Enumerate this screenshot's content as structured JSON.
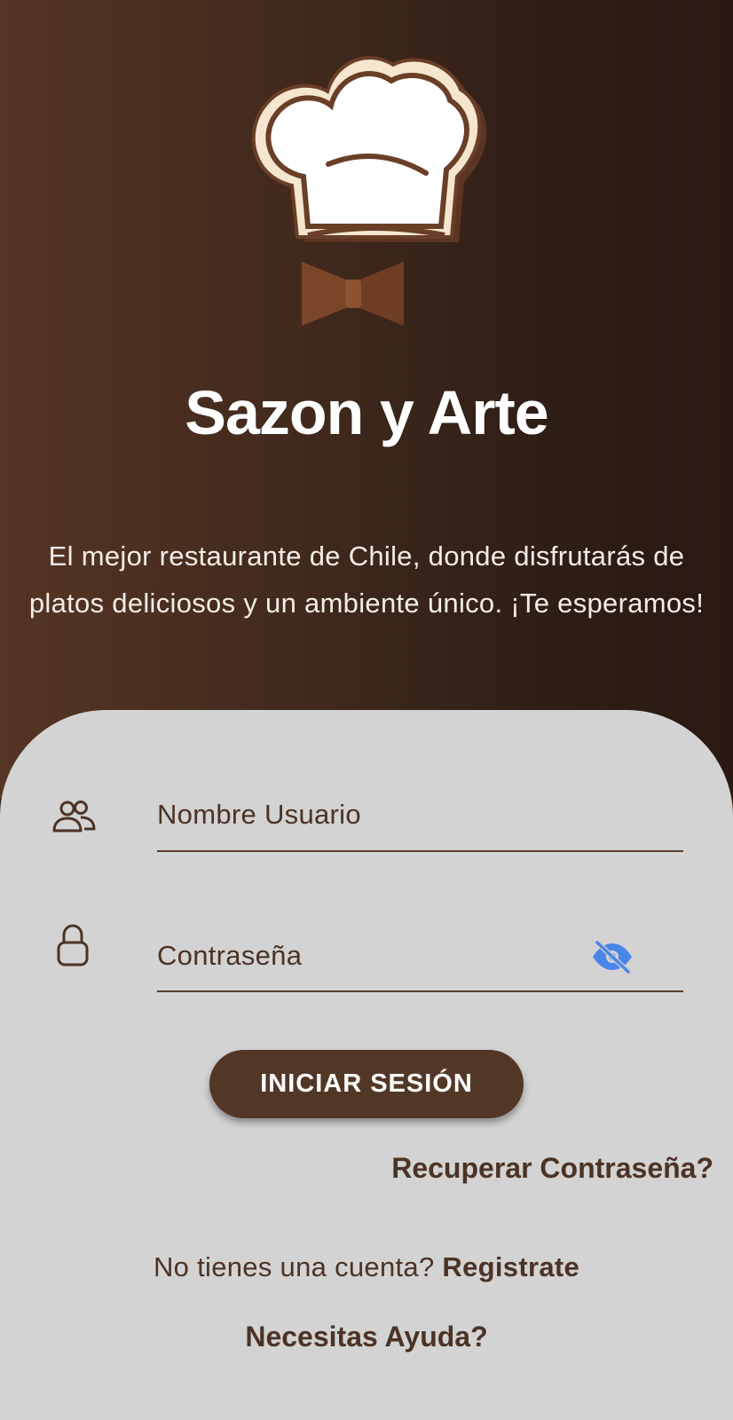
{
  "header": {
    "logo_icon": "chef-hat-with-bowtie",
    "title": "Sazon y Arte",
    "tagline": "El mejor restaurante de Chile, donde disfrutarás de platos deliciosos y un ambiente único. ¡Te esperamos!"
  },
  "login_form": {
    "username": {
      "icon": "users-icon",
      "placeholder": "Nombre Usuario",
      "value": ""
    },
    "password": {
      "icon": "lock-icon",
      "placeholder": "Contraseña",
      "value": "",
      "toggle_icon": "eye-off-icon"
    },
    "submit_label": "INICIAR SESIÓN",
    "recover_label": "Recuperar Contraseña?",
    "register_prompt": "No tienes una cuenta? ",
    "register_label": "Registrate",
    "help_label": "Necesitas Ayuda?"
  },
  "colors": {
    "brand_brown": "#533726",
    "panel_gray": "#d3d3d3",
    "text_brown": "#4b3325",
    "eye_icon_blue": "#4a86e8"
  }
}
